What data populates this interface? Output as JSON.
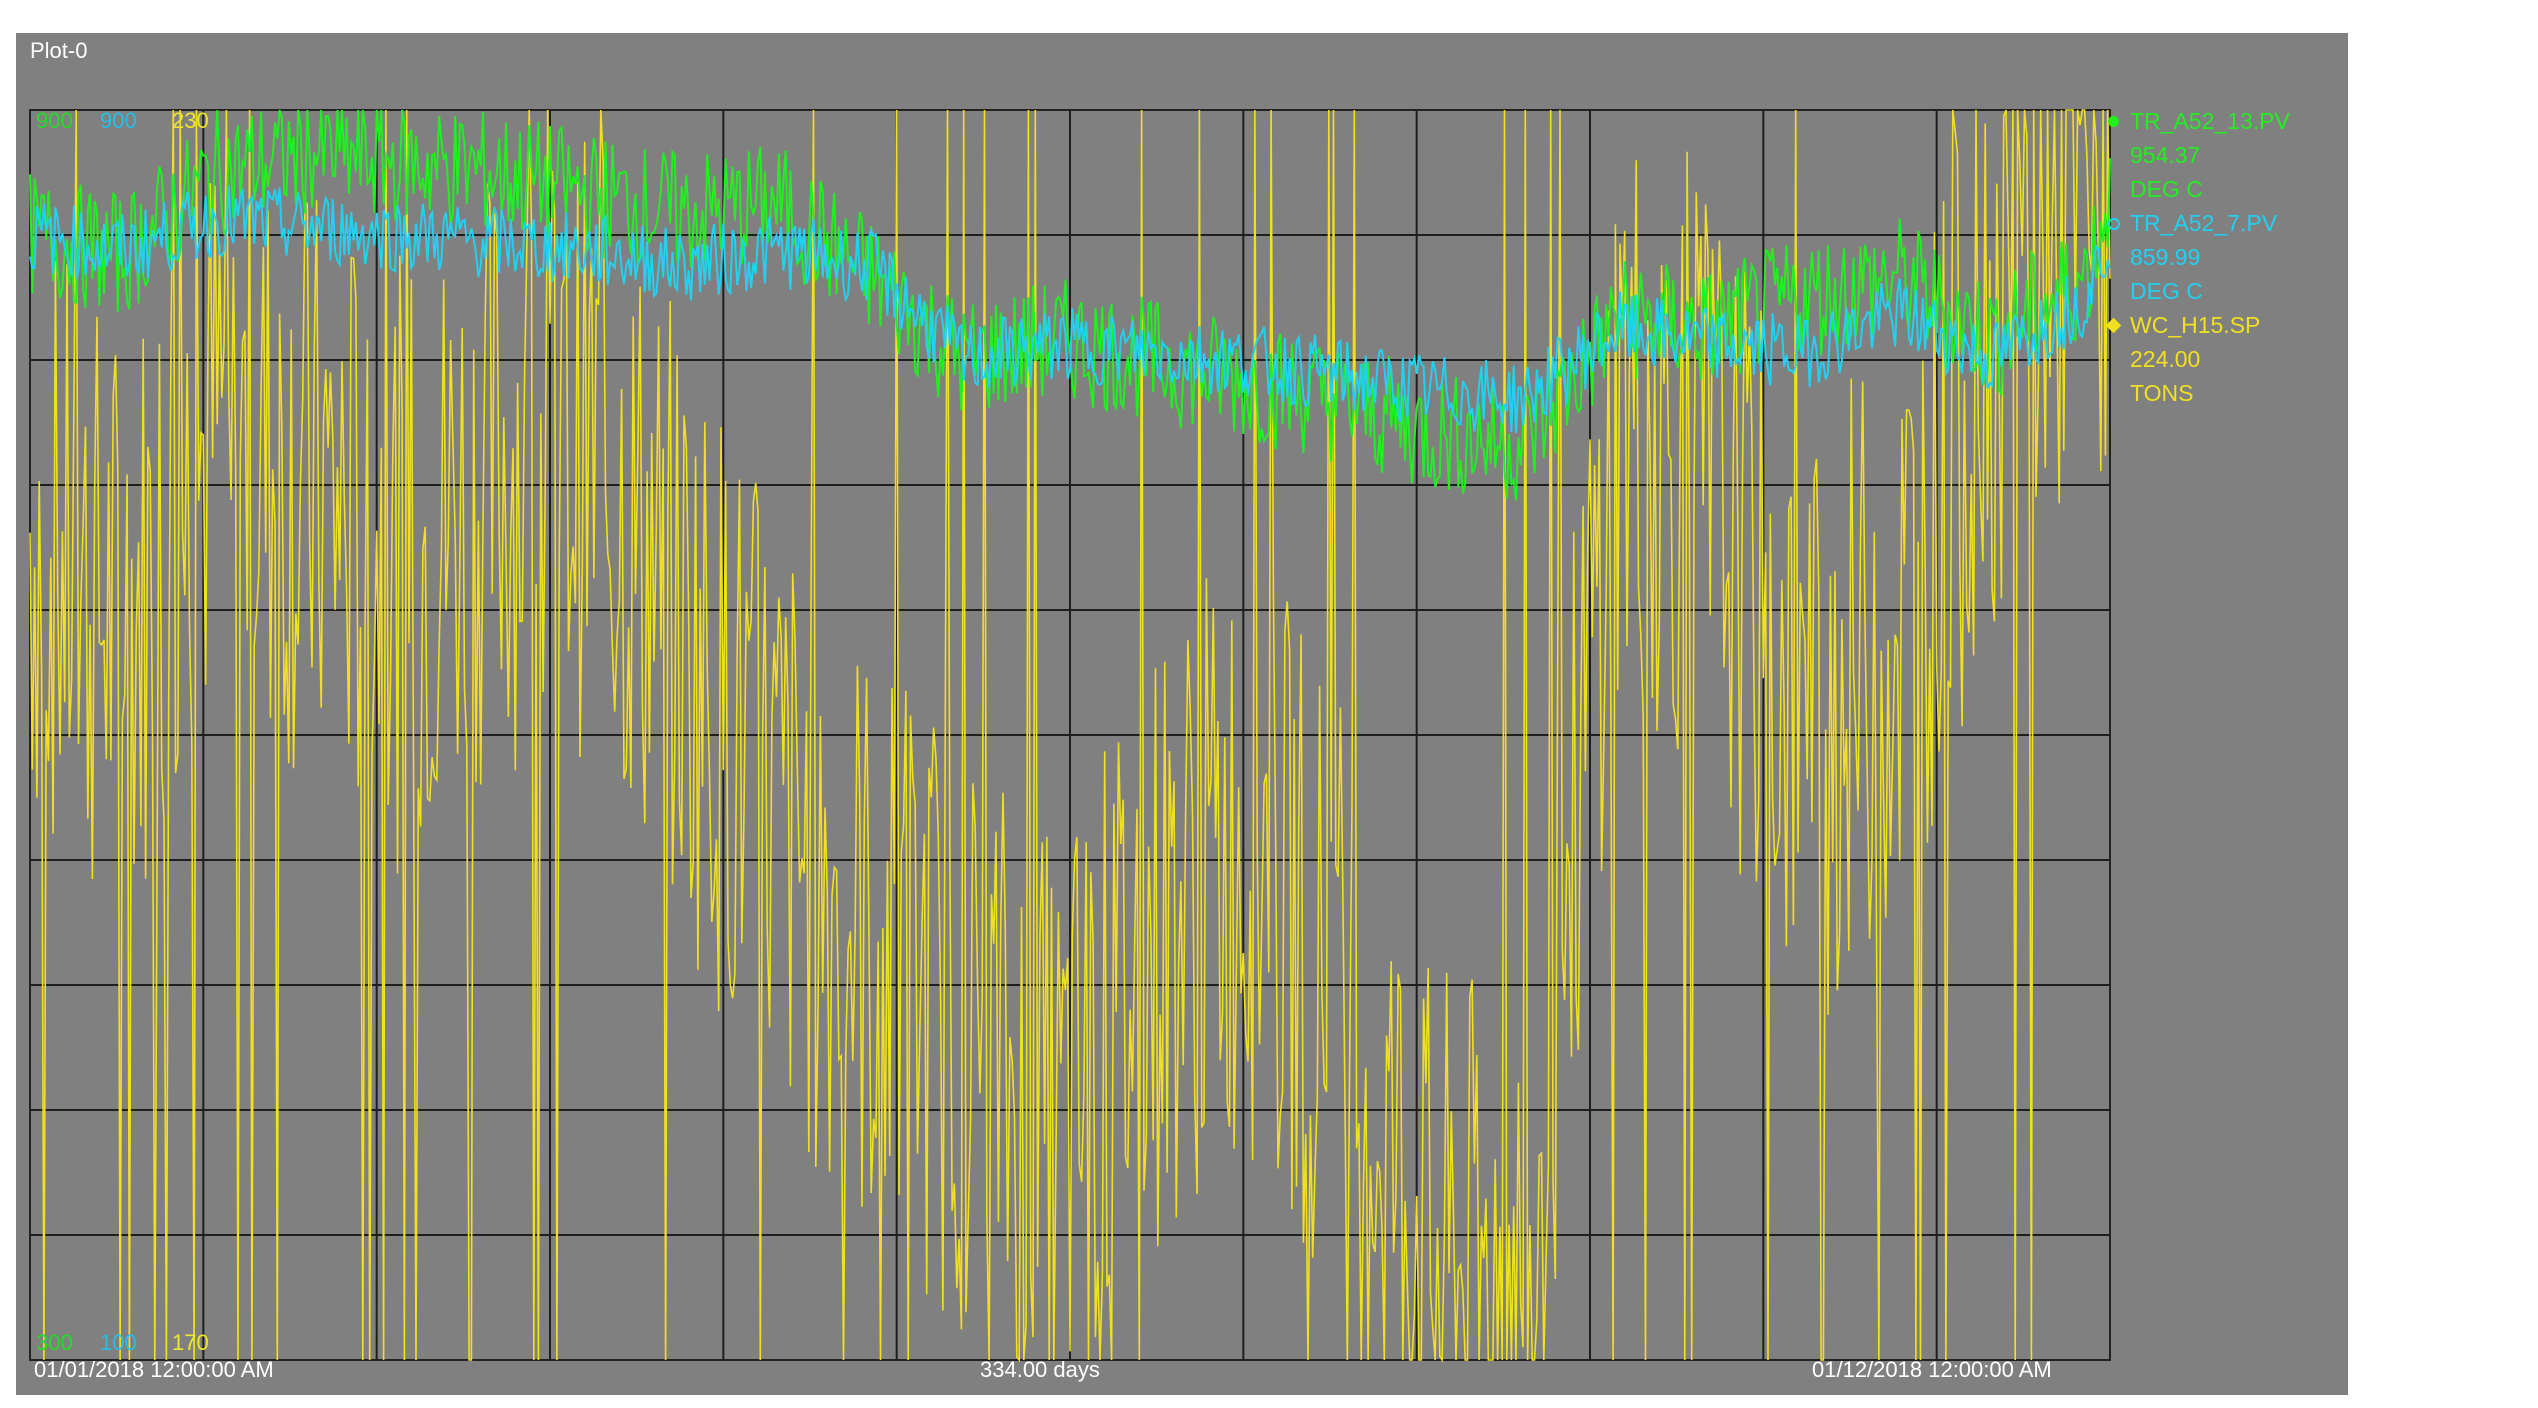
{
  "plot": {
    "title": "Plot-0"
  },
  "axes": {
    "ticks": [
      {
        "text": "900",
        "color": "#22dd22"
      },
      {
        "text": "900",
        "color": "#22c0e6"
      },
      {
        "text": "230",
        "color": "#f0e62a"
      },
      {
        "text": "300",
        "color": "#22dd22"
      },
      {
        "text": "100",
        "color": "#22c0e6"
      },
      {
        "text": "170",
        "color": "#f0e62a"
      }
    ]
  },
  "footer": {
    "start": "01/01/2018 12:00:00 AM",
    "span": "334.00 days",
    "end": "01/12/2018 12:00:00 AM"
  },
  "legend": [
    {
      "tag": "TR_A52_13.PV",
      "value": "954.37",
      "unit": "DEG C",
      "color": "#22ee22",
      "marker": "circle-filled"
    },
    {
      "tag": "TR_A52_7.PV",
      "value": "859.99",
      "unit": "DEG C",
      "color": "#22d0f0",
      "marker": "circle-open"
    },
    {
      "tag": "WC_H15.SP",
      "value": "224.00",
      "unit": "TONS",
      "color": "#f0e020",
      "marker": "diamond"
    }
  ],
  "chart_data": {
    "type": "line",
    "title": "Plot-0",
    "x_start": "01/01/2018 12:00:00 AM",
    "x_end": "01/12/2018 12:00:00 AM",
    "x_span": "334.00 days",
    "x": [
      0,
      15,
      30,
      45,
      60,
      75,
      90,
      105,
      120,
      135,
      150,
      165,
      180,
      195,
      210,
      225,
      240,
      255,
      270,
      285,
      300,
      315,
      330,
      334
    ],
    "grid": true,
    "legend_position": "right",
    "series": [
      {
        "name": "TR_A52_13.PV",
        "unit": "DEG C",
        "axis": "left",
        "ylim": [
          300,
          900
        ],
        "color": "#22ee22",
        "values": [
          840,
          830,
          870,
          880,
          875,
          870,
          860,
          850,
          855,
          820,
          780,
          790,
          780,
          770,
          760,
          745,
          740,
          800,
          795,
          810,
          820,
          790,
          820,
          860
        ]
      },
      {
        "name": "TR_A52_7.PV",
        "unit": "DEG C",
        "axis": "left",
        "ylim": [
          100,
          900
        ],
        "color": "#22d0f0",
        "values": [
          820,
          810,
          830,
          825,
          820,
          815,
          810,
          800,
          810,
          800,
          740,
          750,
          745,
          740,
          730,
          720,
          715,
          760,
          750,
          745,
          770,
          740,
          780,
          820
        ]
      },
      {
        "name": "WC_H15.SP",
        "unit": "TONS",
        "axis": "right",
        "ylim": [
          170,
          230
        ],
        "color": "#f0e020",
        "values": [
          210,
          205,
          215,
          212,
          208,
          213,
          214,
          205,
          196,
          190,
          186,
          180,
          190,
          195,
          188,
          174,
          173,
          216,
          212,
          200,
          205,
          220,
          226,
          224
        ]
      }
    ]
  }
}
